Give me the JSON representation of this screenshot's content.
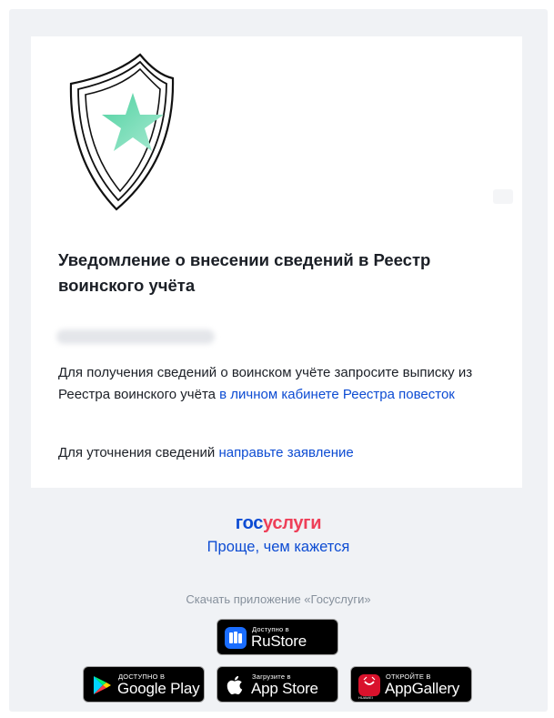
{
  "notification": {
    "title": "Уведомление о внесении сведений в Реестр воинского учёта",
    "para1_text": "Для получения сведений о воинском учёте запросите выписку из Реестра воинского учёта ",
    "para1_link": "в личном кабинете Реестра повесток",
    "para2_text": "Для уточнения сведений ",
    "para2_link": "направьте заявление"
  },
  "footer": {
    "logo_part1": "гос",
    "logo_part2": "услуги",
    "slogan": "Проще, чем кажется",
    "download_text": "Скачать приложение «Госуслуги»"
  },
  "stores": {
    "rustore": {
      "small": "Доступно в",
      "big": "RuStore"
    },
    "google_play": {
      "small": "ДОСТУПНО В",
      "big": "Google Play"
    },
    "app_store": {
      "small": "Загрузите в",
      "big": "App Store"
    },
    "app_gallery": {
      "small": "ОТКРОЙТЕ В",
      "big": "AppGallery",
      "brand": "HUAWEI"
    }
  },
  "colors": {
    "accent_blue": "#0d4cd3",
    "accent_red": "#ee3f58",
    "star_green": "#56d1a4",
    "background": "#f0f2f5"
  },
  "icons": [
    "shield-star-icon",
    "rustore-icon",
    "google-play-icon",
    "apple-icon",
    "huawei-icon"
  ]
}
